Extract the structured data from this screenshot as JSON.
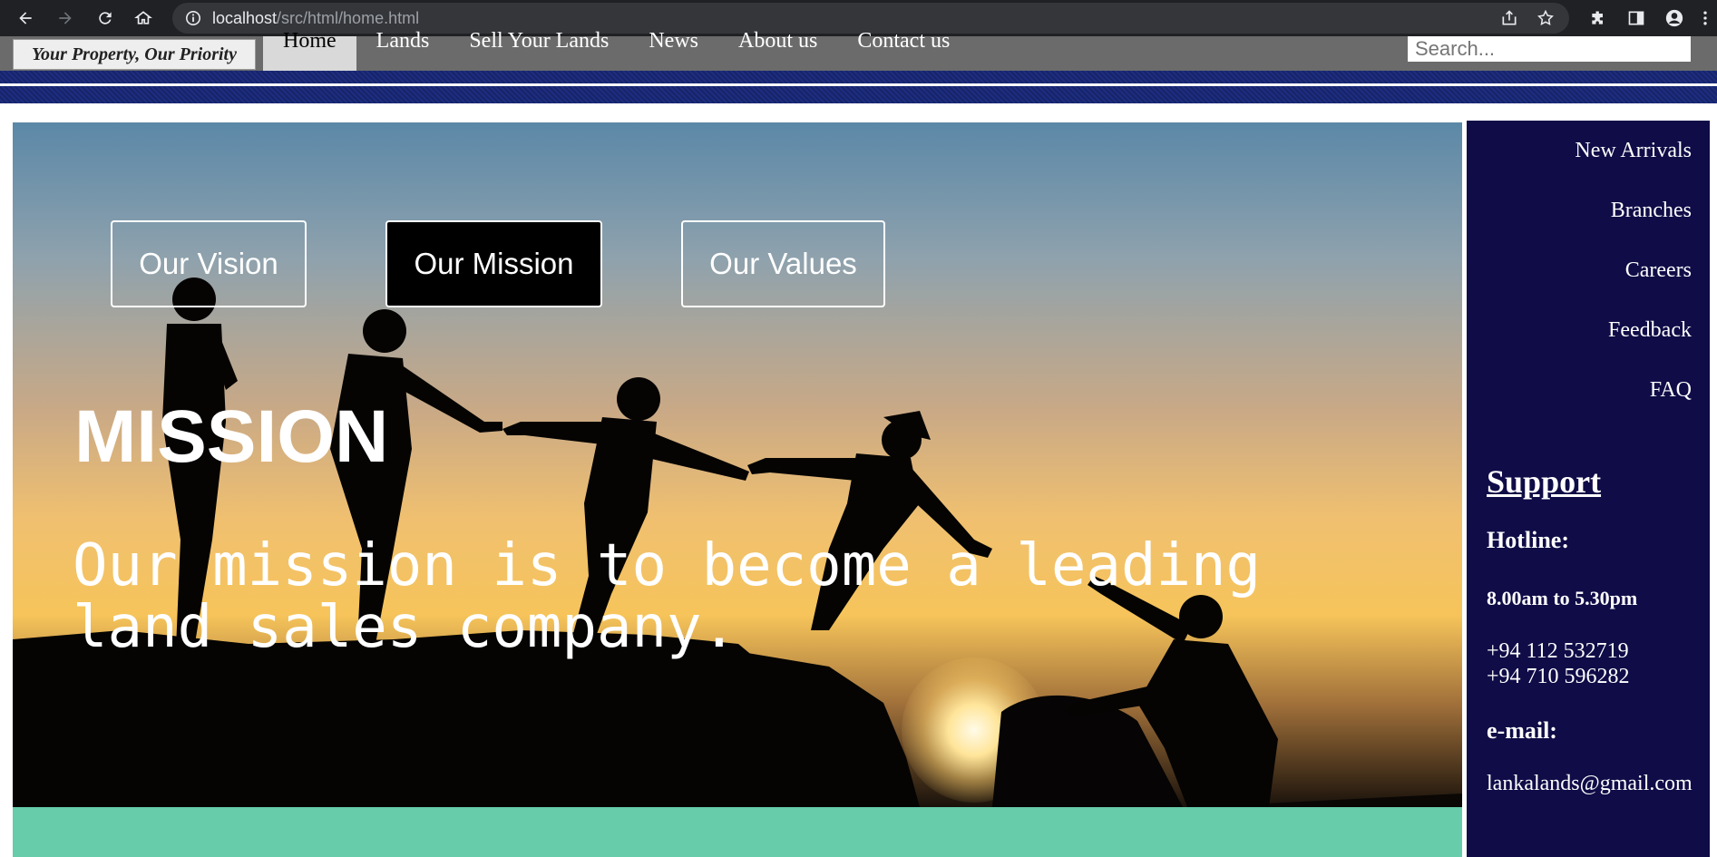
{
  "browser": {
    "url_host": "localhost",
    "url_path": "/src/html/home.html"
  },
  "header": {
    "logo_text": "Your Property, Our Priority",
    "menu": [
      {
        "label": "Home",
        "active": true
      },
      {
        "label": "Lands"
      },
      {
        "label": "Sell Your Lands"
      },
      {
        "label": "News"
      },
      {
        "label": "About us"
      },
      {
        "label": "Contact us"
      }
    ],
    "search_placeholder": "Search..."
  },
  "hero": {
    "tabs": [
      {
        "label": "Our Vision"
      },
      {
        "label": "Our Mission",
        "active": true
      },
      {
        "label": "Our Values"
      }
    ],
    "title": "MISSION",
    "text": "Our mission is to become a leading land sales company."
  },
  "sidebar": {
    "links": [
      {
        "label": "New Arrivals"
      },
      {
        "label": "Branches"
      },
      {
        "label": "Careers"
      },
      {
        "label": "Feedback"
      },
      {
        "label": "FAQ"
      }
    ],
    "support_title": "Support",
    "hotline_label": "Hotline:",
    "hours": "8.00am to 5.30pm",
    "phone1": "+94 112 532719",
    "phone2": "+94 710 596282",
    "email_label": "e-mail:",
    "email": "lankalands@gmail.com"
  },
  "colors": {
    "sidebar_bg": "#0f0c47",
    "header_bar": "#6b6b6b",
    "teal_strip": "#66ccaa"
  }
}
